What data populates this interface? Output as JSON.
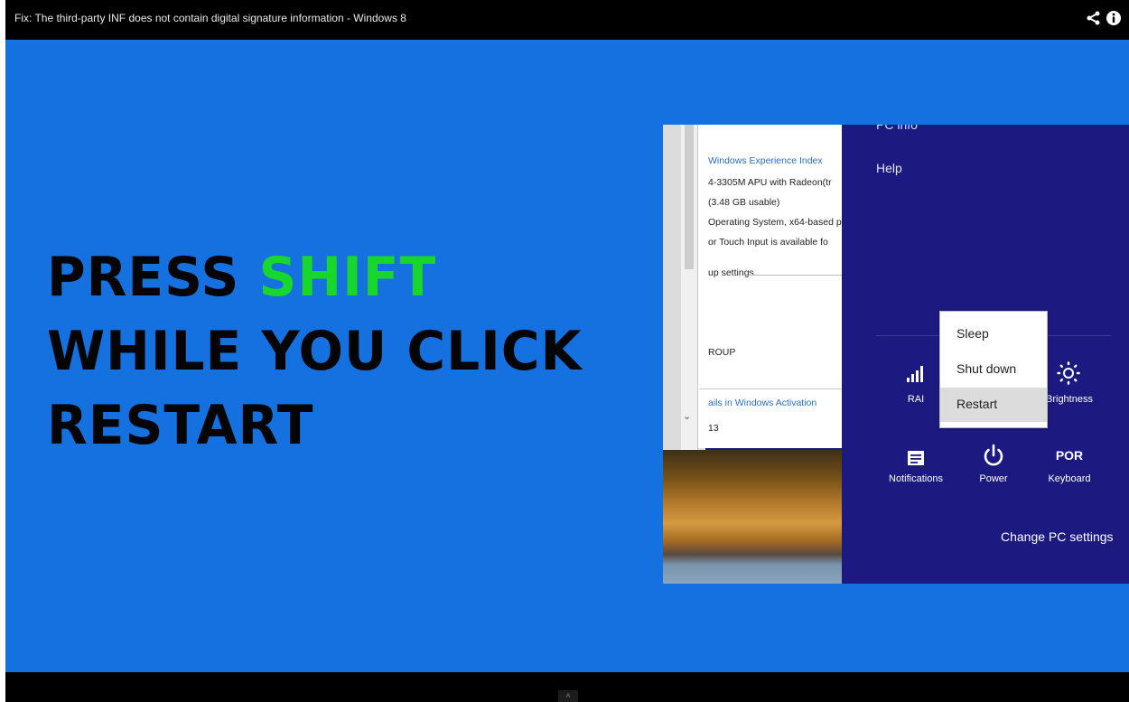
{
  "window": {
    "title": "Fix: The third-party INF does not contain digital signature information - Windows 8",
    "icons": [
      "share-icon",
      "info-icon"
    ]
  },
  "headline": {
    "line1_prefix": "PRESS ",
    "line1_highlight": "SHIFT",
    "line2": "WHILE YOU CLICK",
    "line3": "RESTART",
    "highlight_color": "#19d62c",
    "background_color": "#1570e0"
  },
  "system_properties": {
    "link_experience": "Windows Experience Index",
    "processor": "4-3305M APU with Radeon(tr",
    "memory": "(3.48 GB usable)",
    "system_type": "Operating System, x64-based p",
    "pen_touch": "or Touch Input is available fo",
    "settings_group": "up settings",
    "workgroup": "ROUP",
    "link_activation": "ails in Windows Activation",
    "product_id": "13"
  },
  "charms": {
    "pc_info": "PC info",
    "help": "Help",
    "tiles": [
      {
        "icon": "signal-icon",
        "label": "RAI"
      },
      {
        "icon": "brightness-icon",
        "label": "Brightness"
      },
      {
        "icon": "notifications-icon",
        "label": "Notifications"
      },
      {
        "icon": "power-icon",
        "label": "Power"
      },
      {
        "icon": "keyboard-icon",
        "label": "Keyboard",
        "glyph": "POR"
      }
    ],
    "change_pc_settings": "Change PC settings"
  },
  "power_menu": {
    "items": [
      "Sleep",
      "Shut down",
      "Restart"
    ],
    "highlighted": "Restart"
  },
  "player": {
    "expand_glyph": "˄"
  }
}
